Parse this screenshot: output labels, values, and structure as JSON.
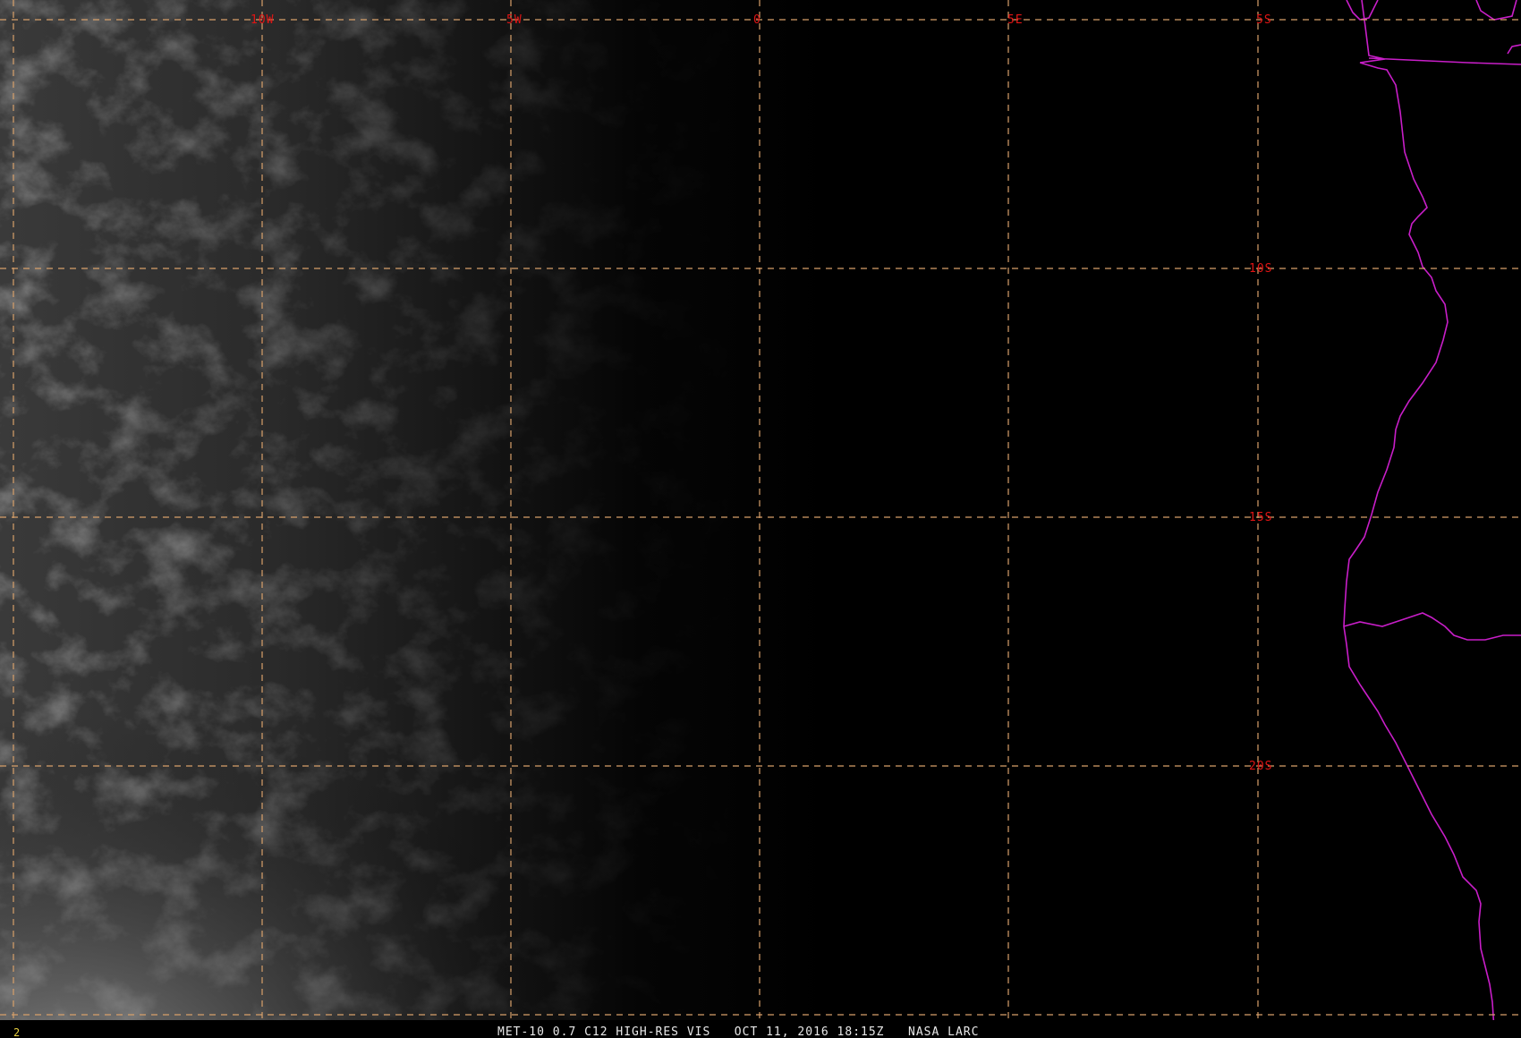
{
  "map": {
    "footer": {
      "frame_number": "2",
      "caption": "MET-10 0.7 C12 HIGH-RES VIS   OCT 11, 2016 18:15Z   NASA LARC"
    },
    "longitude_labels": [
      "10W",
      "5W",
      "0",
      "5E",
      "5S"
    ],
    "latitude_labels": [
      "10S",
      "15S",
      "20S"
    ],
    "colors": {
      "background": "#000000",
      "grid": "#d8a06a",
      "grid_labels": "#e01414",
      "coastline": "#c81ec8",
      "footer_text": "#e8e8e8",
      "frame_number": "#e8d040"
    },
    "imagery": "satellite visible channel, clouds over ocean at left, dark night side at right"
  }
}
